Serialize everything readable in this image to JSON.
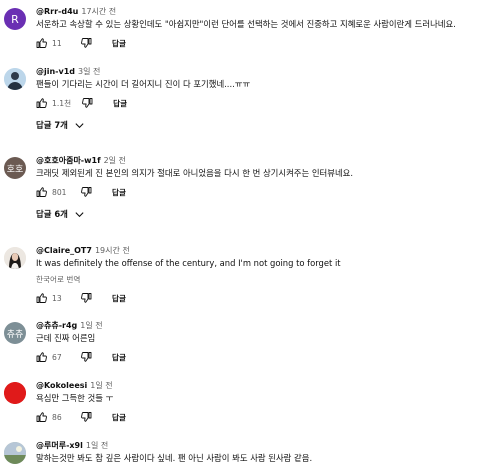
{
  "comments": [
    {
      "handle": "@Rrr-d4u",
      "time": "17시간 전",
      "avatar_letter": "R",
      "text": "서운하고 속상할 수 있는 상황인데도 \"아쉽지만\"이런 단어를 선택하는 것에서 진중하고 지혜로운 사람이란게 드러나네요.",
      "likes": "11",
      "reply_label": "답글"
    },
    {
      "handle": "@jin-v1d",
      "time": "3일 전",
      "text": "팬들이 기다리는 시간이 더 길어지니 진이 다 포기했네....ㅠㅠ",
      "likes": "1.1천",
      "reply_label": "답글",
      "replies_label": "답글 7개"
    },
    {
      "handle": "@호호아줌마-w1f",
      "time": "2일 전",
      "avatar_letter": "호호",
      "text": "크래딧 제외된게 진 본인의 의지가 절대로 아니었음을 다시 한 번 상기시켜주는 인터뷰네요.",
      "likes": "801",
      "reply_label": "답글",
      "replies_label": "답글 6개"
    },
    {
      "handle": "@Claire_OT7",
      "time": "19시간 전",
      "text": "It was definitely the offense of the century, and I'm not going to forget it",
      "translate_label": "한국어로 번역",
      "likes": "13",
      "reply_label": "답글"
    },
    {
      "handle": "@츄츄-r4g",
      "time": "1일 전",
      "avatar_letter": "츄츄",
      "text": "근데 진짜 어른임",
      "likes": "67",
      "reply_label": "답글"
    },
    {
      "handle": "@Kokoleesi",
      "time": "1일 전",
      "text": "욕심만 그득한 것들 ㅜ",
      "likes": "86",
      "reply_label": "답글"
    },
    {
      "handle": "@루머루-x9l",
      "time": "1일 전",
      "text": "말하는것만 봐도 참 깊은 사람이다 싶네. 팬 아닌 사람이 봐도 사람 된사람 같음."
    }
  ],
  "colors": {
    "avatar_r": "#6a2fb3",
    "avatar_hoho": "#6b5a52",
    "avatar_chuchu": "#7d8f96",
    "avatar_koko": "#e01a1a",
    "text": "#0f0f0f",
    "muted": "#606060"
  }
}
